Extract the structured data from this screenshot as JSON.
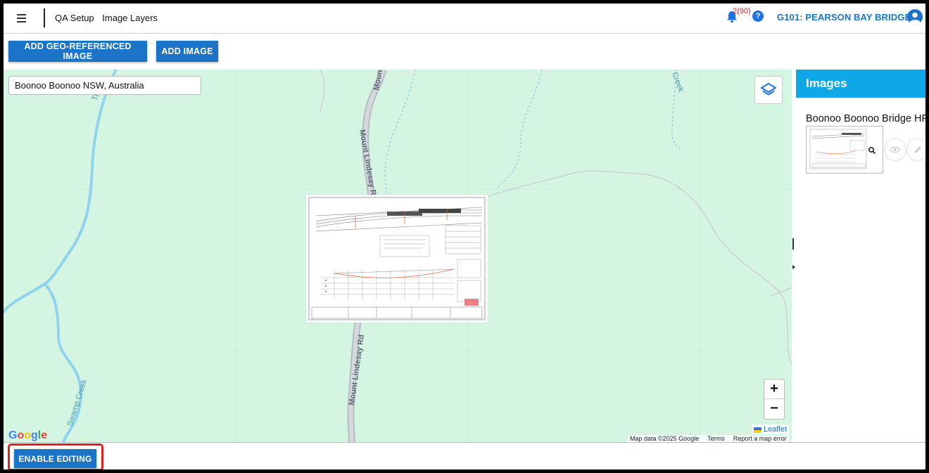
{
  "header": {
    "breadcrumb": [
      "QA Setup",
      "Image Layers"
    ],
    "notification_count": "2(90)",
    "help_label": "?",
    "project": "G101: PEARSON BAY BRIDGE"
  },
  "toolbar": {
    "add_geo_label": "ADD GEO-REFERENCED IMAGE",
    "add_image_label": "ADD IMAGE"
  },
  "map": {
    "search_value": "Boonoo Boonoo NSW, Australia",
    "zoom_in": "+",
    "zoom_out": "−",
    "google_logo": "Google",
    "leaflet_label": "Leaflet",
    "attribution": {
      "map_data": "Map data ©2025 Google",
      "terms": "Terms",
      "report": "Report a map error"
    },
    "labels": {
      "road_top": "Mount",
      "road_mid": "Mount Lindesay Rd",
      "road_bottom": "Mount Lindesay Rd",
      "creek_left": "Swamp Creek",
      "creek_top_left": "Tile",
      "creek_top_right": "Creek"
    }
  },
  "panel": {
    "title": "Images",
    "image_name": "Boonoo Boonoo Bridge HF"
  },
  "footer": {
    "enable_editing_label": "ENABLE EDITING"
  },
  "colors": {
    "primary": "#1b74c8",
    "panel_header": "#0fa7e6",
    "map_bg": "#d5f5e3",
    "water": "#8fd3ee",
    "highlight": "#e0201c"
  }
}
